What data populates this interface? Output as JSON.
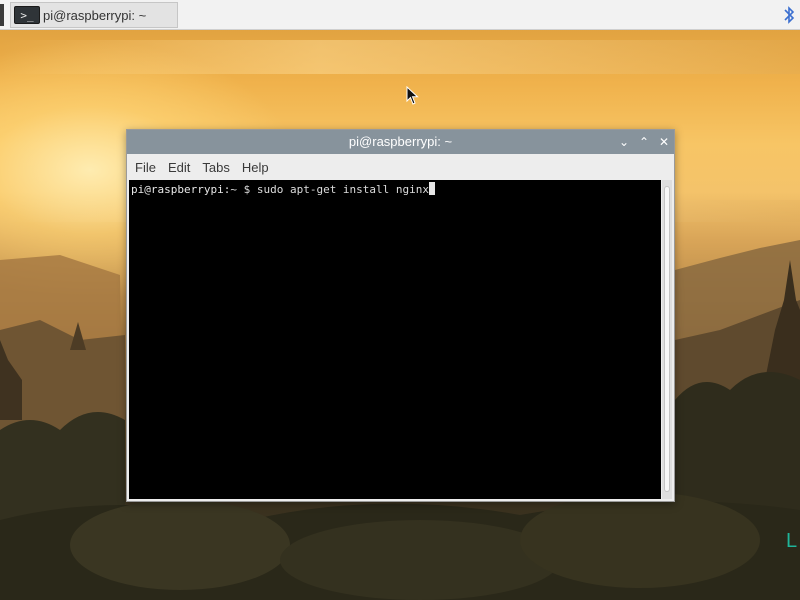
{
  "taskbar": {
    "app_button": {
      "icon": "terminal-icon",
      "icon_glyph": ">_",
      "label": "pi@raspberrypi: ~"
    },
    "tray": {
      "bluetooth_icon": "bluetooth-icon"
    }
  },
  "terminal_window": {
    "title": "pi@raspberrypi: ~",
    "controls": {
      "minimize": "⌄",
      "maximize": "⌃",
      "close": "✕"
    },
    "menu": [
      "File",
      "Edit",
      "Tabs",
      "Help"
    ],
    "content": {
      "prompt_user": "pi@raspberrypi",
      "prompt_rest": ":~ $ ",
      "command": "sudo apt-get install nginx"
    }
  },
  "desktop": {
    "edge_text": "L"
  },
  "colors": {
    "titlebar": "#87939c",
    "terminal_bg": "#000000",
    "desktop_sky": "#f0b24c"
  }
}
